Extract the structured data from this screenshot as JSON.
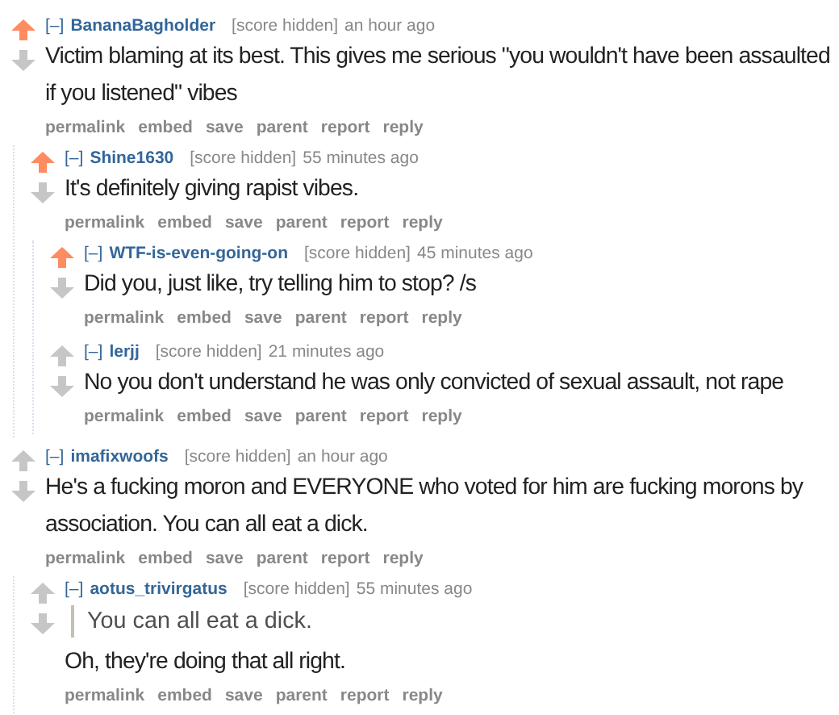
{
  "comments": [
    {
      "toggle": "[–]",
      "author": "BananaBagholder",
      "score": "[score hidden]",
      "time": "an hour ago",
      "upvoted": true,
      "body": [
        {
          "kind": "text",
          "text": "Victim blaming at its best. This gives me serious \"you wouldn't have been assaulted if you listened\" vibes"
        }
      ],
      "actions": [
        "permalink",
        "embed",
        "save",
        "parent",
        "report",
        "reply"
      ],
      "children": [
        {
          "toggle": "[–]",
          "author": "Shine1630",
          "score": "[score hidden]",
          "time": "55 minutes ago",
          "upvoted": true,
          "body": [
            {
              "kind": "text",
              "text": "It's definitely giving rapist vibes."
            }
          ],
          "actions": [
            "permalink",
            "embed",
            "save",
            "parent",
            "report",
            "reply"
          ],
          "children": [
            {
              "toggle": "[–]",
              "author": "WTF-is-even-going-on",
              "score": "[score hidden]",
              "time": "45 minutes ago",
              "upvoted": true,
              "body": [
                {
                  "kind": "text",
                  "text": "Did you, just like, try telling him to stop? /s"
                }
              ],
              "actions": [
                "permalink",
                "embed",
                "save",
                "parent",
                "report",
                "reply"
              ]
            },
            {
              "toggle": "[–]",
              "author": "lerjj",
              "score": "[score hidden]",
              "time": "21 minutes ago",
              "upvoted": false,
              "body": [
                {
                  "kind": "text",
                  "text": "No you don't understand he was only convicted of sexual assault, not rape"
                }
              ],
              "actions": [
                "permalink",
                "embed",
                "save",
                "parent",
                "report",
                "reply"
              ]
            }
          ]
        }
      ]
    },
    {
      "toggle": "[–]",
      "author": "imafixwoofs",
      "score": "[score hidden]",
      "time": "an hour ago",
      "upvoted": false,
      "body": [
        {
          "kind": "text",
          "text": "He's a fucking moron and EVERYONE who voted for him are fucking morons by association. You can all eat a dick."
        }
      ],
      "actions": [
        "permalink",
        "embed",
        "save",
        "parent",
        "report",
        "reply"
      ],
      "children": [
        {
          "toggle": "[–]",
          "author": "aotus_trivirgatus",
          "score": "[score hidden]",
          "time": "55 minutes ago",
          "upvoted": false,
          "body": [
            {
              "kind": "quote",
              "text": "You can all eat a dick."
            },
            {
              "kind": "text",
              "text": "Oh, they're doing that all right."
            }
          ],
          "actions": [
            "permalink",
            "embed",
            "save",
            "parent",
            "report",
            "reply"
          ]
        }
      ]
    }
  ]
}
